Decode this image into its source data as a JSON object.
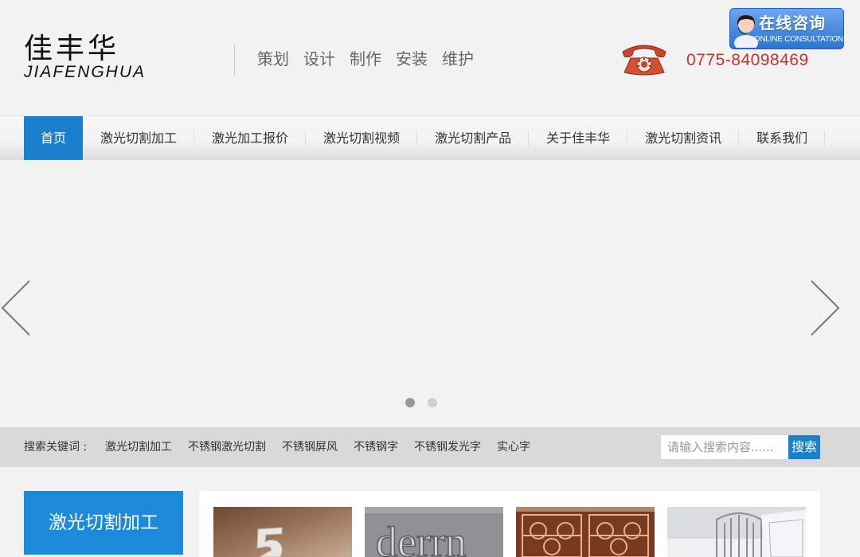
{
  "header": {
    "logo_cn": "佳丰华",
    "logo_en": "JIAFENGHUA",
    "slogans": [
      "策划",
      "设计",
      "制作",
      "安装",
      "维护"
    ],
    "phone": "0775-84098469",
    "consult_cn": "在线咨询",
    "consult_en": "ONLINE CONSULTATION"
  },
  "nav": {
    "items": [
      "首页",
      "激光切割加工",
      "激光加工报价",
      "激光切割视频",
      "激光切割产品",
      "关于佳丰华",
      "激光切割资讯",
      "联系我们"
    ],
    "active_index": 0
  },
  "banner": {
    "slide_count": 2,
    "active_slide": 0
  },
  "search": {
    "label": "搜索关键词 :",
    "keywords": [
      "激光切割加工",
      "不锈钢激光切割",
      "不锈钢屏风",
      "不锈钢字",
      "不锈钢发光字",
      "实心字"
    ],
    "placeholder": "请输入搜索内容......",
    "button": "搜索"
  },
  "content": {
    "side_title": "激光切割加工",
    "thumb_text": "derrn"
  },
  "colors": {
    "accent": "#1a7fcd",
    "side_title_bg": "#1a8ad9",
    "phone": "#c9312d"
  }
}
